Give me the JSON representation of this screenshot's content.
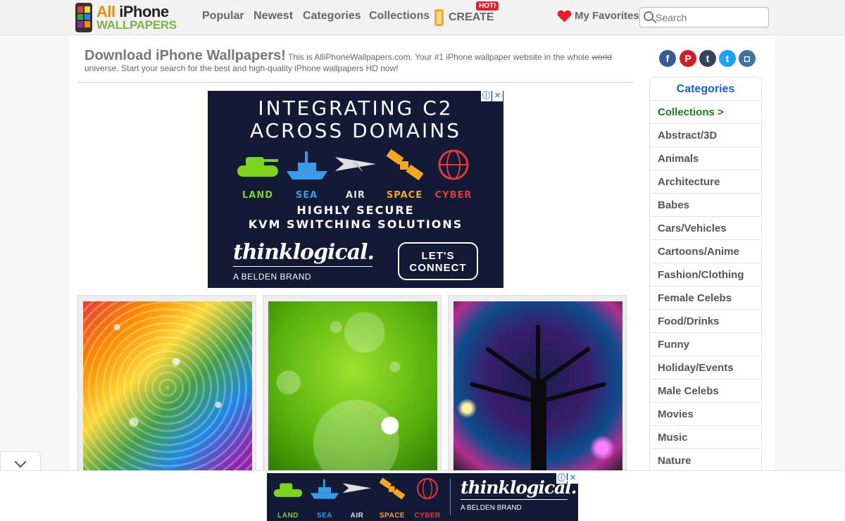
{
  "site": {
    "logo_line1_a": "All",
    "logo_line1_b": "iPhone",
    "logo_line2": "WALLPAPERS"
  },
  "nav": {
    "popular": "Popular",
    "newest": "Newest",
    "categories": "Categories",
    "collections": "Collections",
    "create": "CREATE",
    "hot_badge": "HOT!",
    "favorites": "My Favorites"
  },
  "search": {
    "placeholder": "Search"
  },
  "intro": {
    "heading": "Download iPhone Wallpapers!",
    "text_a": "This is AlliPhoneWallpapers.com. Your #1 iPhone wallpaper website in the whole",
    "struck": "world",
    "text_b": "universe. Start your search for the best and high-quality iPhone wallpapers HD now!"
  },
  "ad": {
    "headline_1": "INTEGRATING C2",
    "headline_2": "ACROSS DOMAINS",
    "domains": [
      {
        "label": "LAND",
        "color": "#7ed321",
        "icon": "tank-icon"
      },
      {
        "label": "SEA",
        "color": "#3b9be8",
        "icon": "ship-icon"
      },
      {
        "label": "AIR",
        "color": "#e0e0e0",
        "icon": "jet-icon"
      },
      {
        "label": "SPACE",
        "color": "#f5a623",
        "icon": "satellite-icon"
      },
      {
        "label": "CYBER",
        "color": "#e03a3a",
        "icon": "globe-icon"
      }
    ],
    "sub_1": "HIGHLY SECURE",
    "sub_2": "KVM SWITCHING SOLUTIONS",
    "brand": "thinklogical.",
    "belden": "A BELDEN BRAND",
    "cta_1": "LET'S",
    "cta_2": "CONNECT",
    "info_glyph": "ⓘ",
    "close_glyph": "✕"
  },
  "social": [
    {
      "name": "facebook-icon",
      "glyph": "f",
      "color": "#3b5998"
    },
    {
      "name": "pinterest-icon",
      "glyph": "P",
      "color": "#cb2027"
    },
    {
      "name": "tumblr-icon",
      "glyph": "t",
      "color": "#35465c"
    },
    {
      "name": "twitter-icon",
      "glyph": "t",
      "color": "#1da1f2"
    },
    {
      "name": "instagram-icon",
      "glyph": "◘",
      "color": "#3f729b"
    }
  ],
  "sidebar": {
    "heading": "Categories",
    "collections_link": "Collections >",
    "items": [
      "Abstract/3D",
      "Animals",
      "Architecture",
      "Babes",
      "Cars/Vehicles",
      "Cartoons/Anime",
      "Fashion/Clothing",
      "Female Celebs",
      "Food/Drinks",
      "Funny",
      "Holiday/Events",
      "Male Celebs",
      "Movies",
      "Music",
      "Nature"
    ]
  },
  "colors": {
    "accent_blue": "#1a5fbf",
    "collections_green": "#1b7a1b",
    "hot_red": "#d9232e",
    "ad_navy": "#121a35"
  }
}
